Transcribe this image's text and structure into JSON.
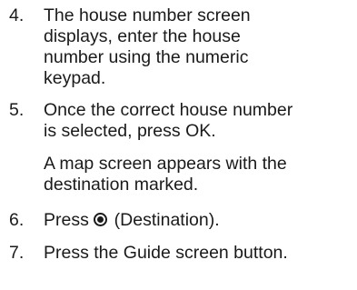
{
  "steps": [
    {
      "number": "4.",
      "lines": [
        "The house number screen",
        "displays, enter the house",
        "number using the numeric",
        "keypad."
      ]
    },
    {
      "number": "5.",
      "lines": [
        "Once the correct house number",
        "is selected, press OK."
      ],
      "note_lines": [
        "A map screen appears with the",
        "destination marked."
      ]
    },
    {
      "number": "6.",
      "before_icon": "Press ",
      "icon": "destination-icon",
      "after_icon": " (Destination)."
    },
    {
      "number": "7.",
      "lines": [
        "Press the Guide screen button."
      ]
    }
  ]
}
